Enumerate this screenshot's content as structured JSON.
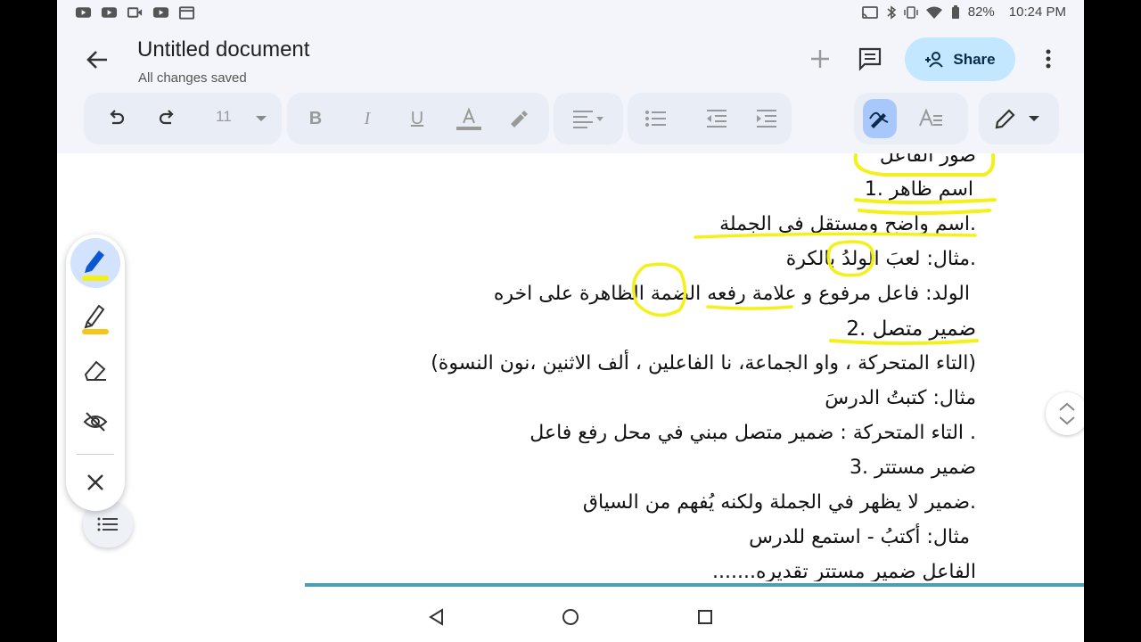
{
  "status_bar": {
    "battery": "82%",
    "time": "10:24 PM"
  },
  "header": {
    "title": "Untitled document",
    "subtitle": "All changes saved",
    "share_label": "Share"
  },
  "toolbar": {
    "font_size": "11"
  },
  "document": {
    "lines": [
      "صور الفاعل",
      "اسم ظاهر .1",
      ".اسم واضح ومستقل في الجملة",
      ".مثال: لعبَ الولدُ بالكرة",
      "الولد: فاعل مرفوع و علامة رفعه الضمة الظاهرة على اخره",
      "ضمير متصل .2",
      "(التاء المتحركة ، واو الجماعة، نا الفاعلين ، ألف الاثنين ،نون النسوة)",
      "مثال: كتبتُ الدرسَ",
      ". التاء المتحركة : ضمير متصل مبني في محل رفع فاعل",
      "ضمير مستتر .3",
      ".ضمير لا يظهر في الجملة ولكنه يُفهم من السياق",
      "مثال: أكتبُ - استمع للدرس",
      "الفاعل ضمير مستتر تقديره......."
    ]
  },
  "colors": {
    "accent": "#c2e7ff",
    "highlighter": "#f4f01a",
    "divider": "#4a9fb3"
  }
}
